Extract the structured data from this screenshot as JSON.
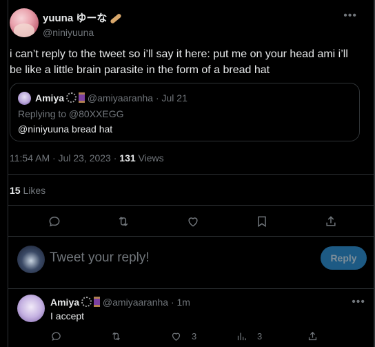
{
  "author": {
    "display_name": "yuuna ゆーな",
    "handle": "@niniyuuna"
  },
  "tweet": {
    "text": "i can’t reply to the tweet so i’ll say it here: put me on your head ami i’ll be like a little brain parasite in the form of a bread hat",
    "timestamp": "11:54 AM · Jul 23, 2023 · ",
    "views_count": "131",
    "views_label": " Views",
    "likes_count": "15",
    "likes_label": " Likes"
  },
  "quote": {
    "display_name": "Amiya",
    "handle_date": "@amiyaaranha · Jul 21",
    "replying_to": "Replying to @80XXEGG",
    "text": "@niniyuuna bread hat"
  },
  "reply_composer": {
    "placeholder": "Tweet your reply!",
    "button_label": "Reply"
  },
  "reply": {
    "display_name": "Amiya",
    "handle_time": "@amiyaaranha · 1m",
    "text": "I accept",
    "likes": "3",
    "views": "3"
  },
  "colors": {
    "background": "#000000",
    "border": "#2f3336",
    "muted": "#71767b",
    "text": "#e7e9ea",
    "reply_button": "#1d5a84"
  },
  "icons": [
    "more-icon",
    "reply-icon",
    "retweet-icon",
    "like-icon",
    "bookmark-icon",
    "share-icon",
    "views-icon"
  ]
}
